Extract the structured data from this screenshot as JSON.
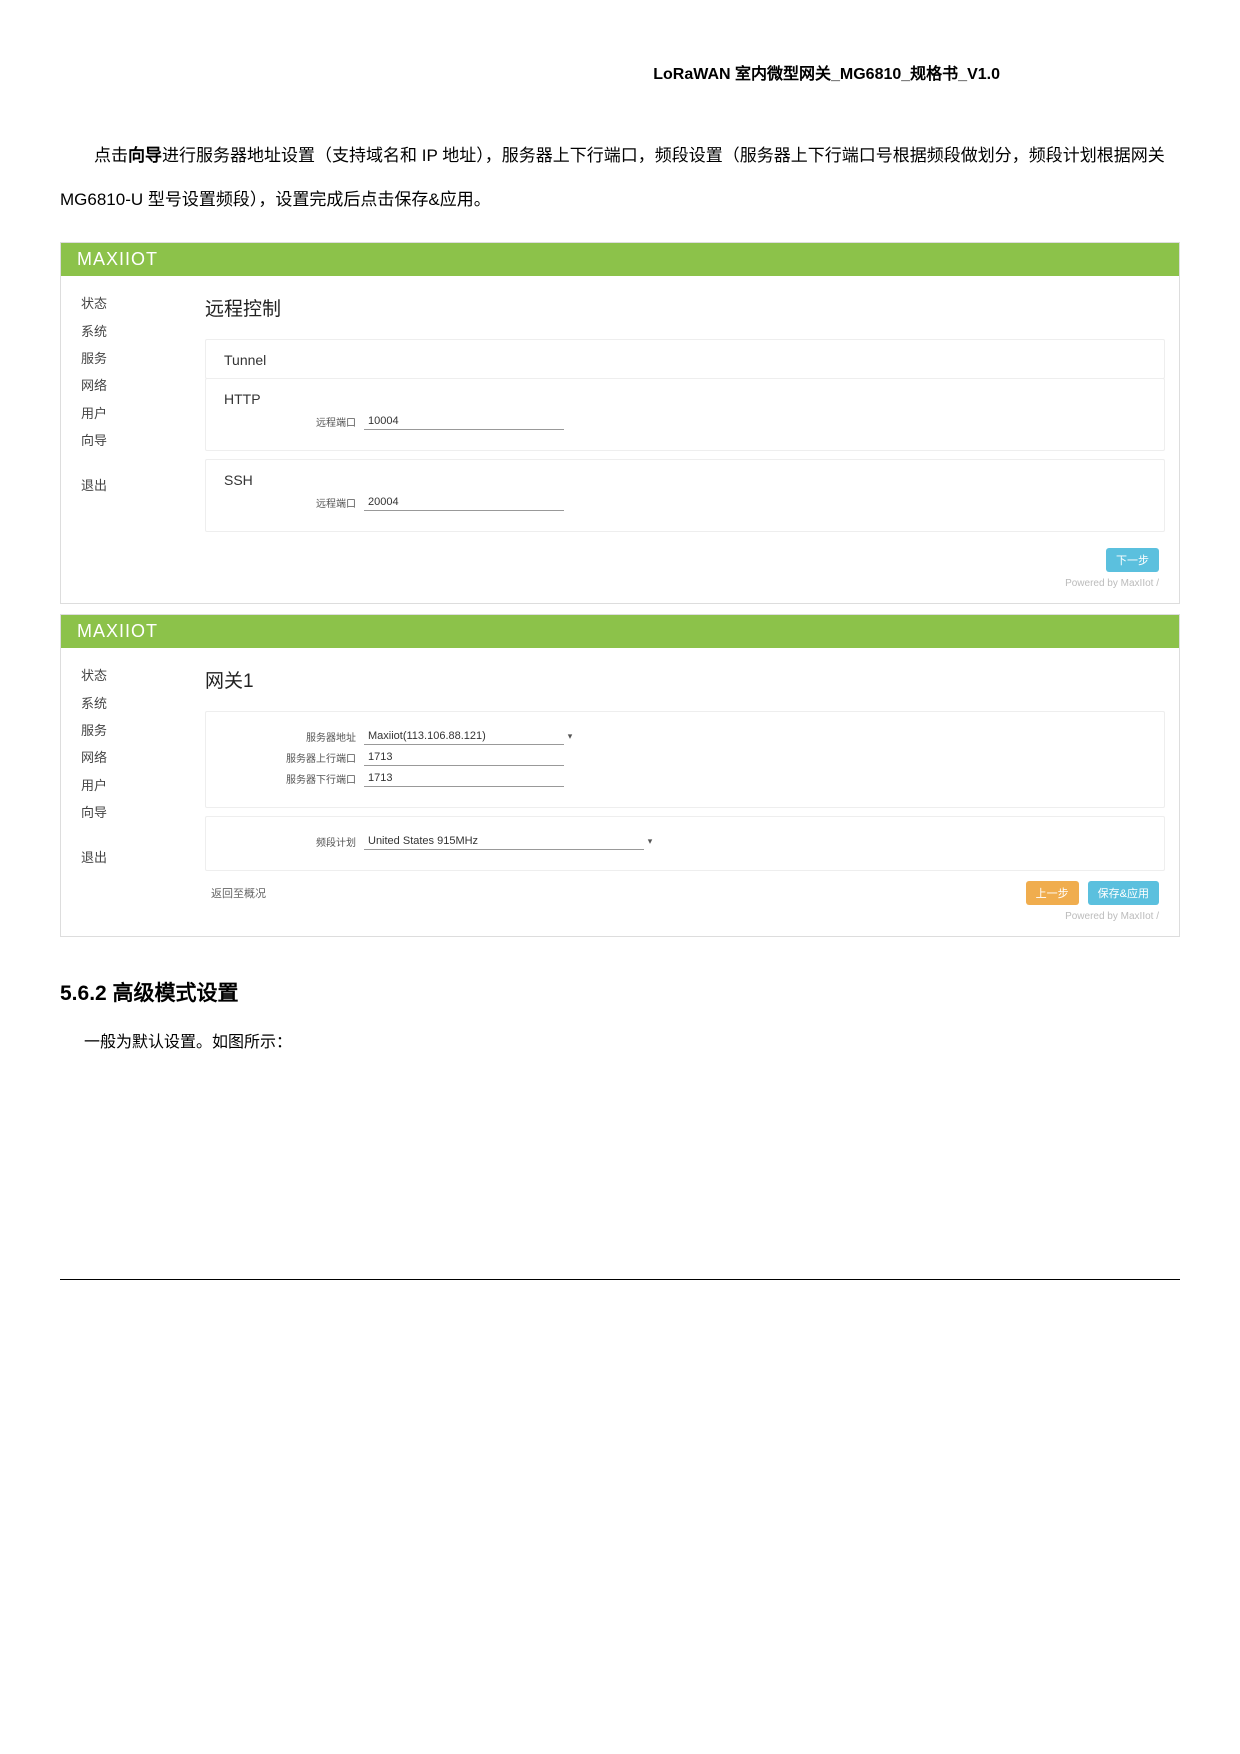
{
  "doc": {
    "header": "LoRaWAN 室内微型网关_MG6810_规格书_V1.0",
    "intro_pre": "点击",
    "intro_bold": "向导",
    "intro_post": "进行服务器地址设置（支持域名和 IP 地址），服务器上下行端口，频段设置（服务器上下行端口号根据频段做划分，频段计划根据网关 MG6810-U 型号设置频段），设置完成后点击保存&应用。",
    "section_heading": "5.6.2 高级模式设置",
    "body_text": "一般为默认设置。如图所示："
  },
  "brand": {
    "pref": "MA",
    "x": "X",
    "suf": "IIOT"
  },
  "sidebar": {
    "items": [
      "状态",
      "系统",
      "服务",
      "网络",
      "用户",
      "向导"
    ],
    "logout": "退出"
  },
  "shot1": {
    "title": "远程控制",
    "tunnel_label": "Tunnel",
    "http_label": "HTTP",
    "http_port_label": "远程端口",
    "http_port_value": "10004",
    "ssh_label": "SSH",
    "ssh_port_label": "远程端口",
    "ssh_port_value": "20004",
    "next_btn": "下一步",
    "powered": "Powered by MaxIIot /"
  },
  "shot2": {
    "title": "网关1",
    "server_addr_label": "服务器地址",
    "server_addr_value": "Maxiiot(113.106.88.121)",
    "uplink_label": "服务器上行端口",
    "uplink_value": "1713",
    "downlink_label": "服务器下行端口",
    "downlink_value": "1713",
    "freq_plan_label": "频段计划",
    "freq_plan_value": "United States 915MHz",
    "back_link": "返回至概况",
    "prev_btn": "上一步",
    "save_btn": "保存&应用",
    "powered": "Powered by MaxIIot /"
  }
}
